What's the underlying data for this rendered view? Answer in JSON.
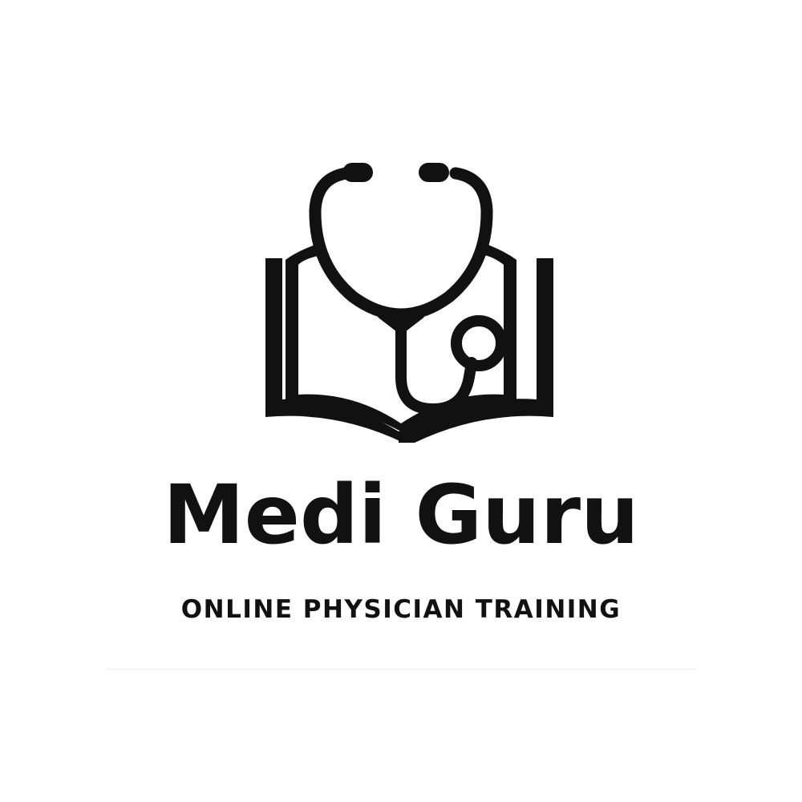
{
  "brand": {
    "name": "Medi Guru",
    "tagline": "ONLINE PHYSICIAN TRAINING"
  },
  "logo": {
    "icon": "book-stethoscope-icon",
    "color": "#111111",
    "background": "#ffffff"
  }
}
